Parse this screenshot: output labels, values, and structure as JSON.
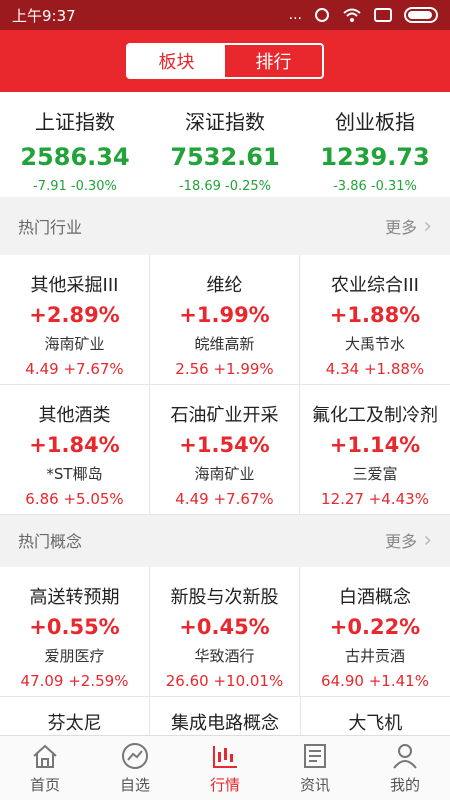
{
  "status": {
    "time": "上午9:37",
    "dots": "...",
    "battery_glyph": "battery-icon"
  },
  "segments": [
    {
      "label": "板块",
      "active": true
    },
    {
      "label": "排行",
      "active": false
    }
  ],
  "indices": [
    {
      "name": "上证指数",
      "value": "2586.34",
      "change": "-7.91  -0.30%"
    },
    {
      "name": "深证指数",
      "value": "7532.61",
      "change": "-18.69  -0.25%"
    },
    {
      "name": "创业板指",
      "value": "1239.73",
      "change": "-3.86  -0.31%"
    }
  ],
  "colors": {
    "up": "#e8282d",
    "down": "#21a33a",
    "brand": "#e8282d"
  },
  "industry": {
    "title": "热门行业",
    "more": "更多",
    "items": [
      {
        "name": "其他采掘III",
        "pct": "+2.89%",
        "stock": "海南矿业",
        "quote": "4.49  +7.67%"
      },
      {
        "name": "维纶",
        "pct": "+1.99%",
        "stock": "皖维高新",
        "quote": "2.56  +1.99%"
      },
      {
        "name": "农业综合III",
        "pct": "+1.88%",
        "stock": "大禹节水",
        "quote": "4.34  +1.88%"
      },
      {
        "name": "其他酒类",
        "pct": "+1.84%",
        "stock": "*ST椰岛",
        "quote": "6.86  +5.05%"
      },
      {
        "name": "石油矿业开采",
        "pct": "+1.54%",
        "stock": "海南矿业",
        "quote": "4.49  +7.67%"
      },
      {
        "name": "氟化工及制冷剂",
        "pct": "+1.14%",
        "stock": "三爱富",
        "quote": "12.27  +4.43%"
      }
    ]
  },
  "concept": {
    "title": "热门概念",
    "more": "更多",
    "items": [
      {
        "name": "高送转预期",
        "pct": "+0.55%",
        "stock": "爱朋医疗",
        "quote": "47.09  +2.59%"
      },
      {
        "name": "新股与次新股",
        "pct": "+0.45%",
        "stock": "华致酒行",
        "quote": "26.60  +10.01%"
      },
      {
        "name": "白酒概念",
        "pct": "+0.22%",
        "stock": "古井贡酒",
        "quote": "64.90  +1.41%"
      }
    ],
    "partial": [
      "芬太尼",
      "集成电路概念",
      "大飞机"
    ]
  },
  "tabs": [
    {
      "label": "首页",
      "icon": "home-icon",
      "active": false
    },
    {
      "label": "自选",
      "icon": "watchlist-icon",
      "active": false
    },
    {
      "label": "行情",
      "icon": "market-icon",
      "active": true
    },
    {
      "label": "资讯",
      "icon": "news-icon",
      "active": false
    },
    {
      "label": "我的",
      "icon": "profile-icon",
      "active": false
    }
  ]
}
